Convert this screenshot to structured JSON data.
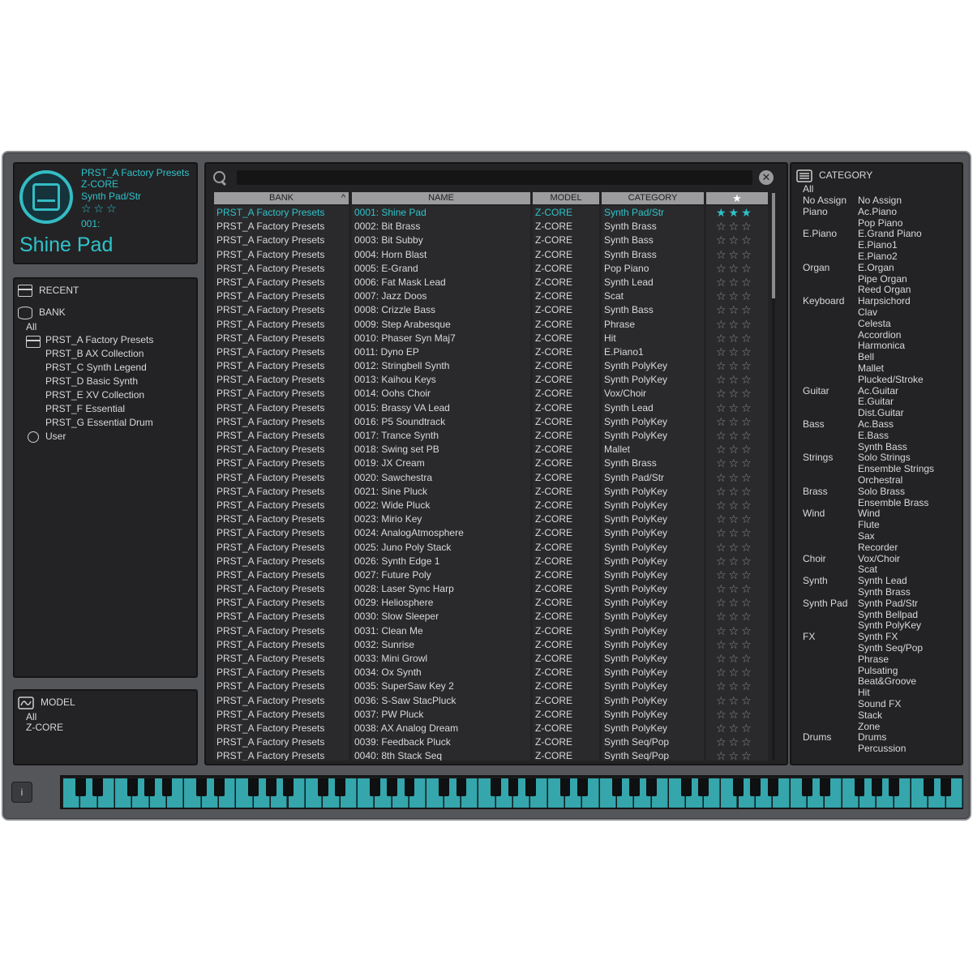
{
  "preset": {
    "bank": "PRST_A Factory Presets",
    "model": "Z-CORE",
    "category": "Synth Pad/Str",
    "stars": "☆☆☆",
    "number": "001:",
    "name": "Shine Pad"
  },
  "browser": {
    "recent_label": "RECENT",
    "bank_label": "BANK",
    "all_label": "All",
    "banks": [
      "PRST_A Factory Presets",
      "PRST_B AX Collection",
      "PRST_C Synth Legend",
      "PRST_D Basic Synth",
      "PRST_E XV Collection",
      "PRST_F Essential",
      "PRST_G Essential Drum"
    ],
    "user_label": "User"
  },
  "model_box": {
    "label": "MODEL",
    "all_label": "All",
    "item": "Z-CORE"
  },
  "search": {
    "placeholder": ""
  },
  "columns": {
    "bank": "BANK",
    "name": "NAME",
    "model": "MODEL",
    "category": "CATEGORY",
    "fav": "★"
  },
  "icons": {
    "search": "search-icon",
    "clear": "clear-icon",
    "recent": "recent-icon",
    "bank": "bank-icon",
    "user": "user-icon",
    "model": "model-wave-icon",
    "category": "category-list-icon",
    "info": "info-icon",
    "sort": "sort-up-icon"
  },
  "colors": {
    "accent": "#2fc3ca",
    "panel": "#232325",
    "frame": "#54565a",
    "header": "#9c9c9e"
  },
  "presets": [
    {
      "bank": "PRST_A Factory Presets",
      "name": "0001: Shine Pad",
      "model": "Z-CORE",
      "category": "Synth Pad/Str",
      "stars": "★★★"
    },
    {
      "bank": "PRST_A Factory Presets",
      "name": "0002: Bit Brass",
      "model": "Z-CORE",
      "category": "Synth Brass",
      "stars": "☆☆☆"
    },
    {
      "bank": "PRST_A Factory Presets",
      "name": "0003: Bit Subby",
      "model": "Z-CORE",
      "category": "Synth Bass",
      "stars": "☆☆☆"
    },
    {
      "bank": "PRST_A Factory Presets",
      "name": "0004: Horn Blast",
      "model": "Z-CORE",
      "category": "Synth Brass",
      "stars": "☆☆☆"
    },
    {
      "bank": "PRST_A Factory Presets",
      "name": "0005: E-Grand",
      "model": "Z-CORE",
      "category": "Pop Piano",
      "stars": "☆☆☆"
    },
    {
      "bank": "PRST_A Factory Presets",
      "name": "0006: Fat Mask Lead",
      "model": "Z-CORE",
      "category": "Synth Lead",
      "stars": "☆☆☆"
    },
    {
      "bank": "PRST_A Factory Presets",
      "name": "0007: Jazz Doos",
      "model": "Z-CORE",
      "category": "Scat",
      "stars": "☆☆☆"
    },
    {
      "bank": "PRST_A Factory Presets",
      "name": "0008: Crizzle Bass",
      "model": "Z-CORE",
      "category": "Synth Bass",
      "stars": "☆☆☆"
    },
    {
      "bank": "PRST_A Factory Presets",
      "name": "0009: Step Arabesque",
      "model": "Z-CORE",
      "category": "Phrase",
      "stars": "☆☆☆"
    },
    {
      "bank": "PRST_A Factory Presets",
      "name": "0010: Phaser Syn Maj7",
      "model": "Z-CORE",
      "category": "Hit",
      "stars": "☆☆☆"
    },
    {
      "bank": "PRST_A Factory Presets",
      "name": "0011: Dyno EP",
      "model": "Z-CORE",
      "category": "E.Piano1",
      "stars": "☆☆☆"
    },
    {
      "bank": "PRST_A Factory Presets",
      "name": "0012: Stringbell Synth",
      "model": "Z-CORE",
      "category": "Synth PolyKey",
      "stars": "☆☆☆"
    },
    {
      "bank": "PRST_A Factory Presets",
      "name": "0013: Kaihou Keys",
      "model": "Z-CORE",
      "category": "Synth PolyKey",
      "stars": "☆☆☆"
    },
    {
      "bank": "PRST_A Factory Presets",
      "name": "0014: Oohs Choir",
      "model": "Z-CORE",
      "category": "Vox/Choir",
      "stars": "☆☆☆"
    },
    {
      "bank": "PRST_A Factory Presets",
      "name": "0015: Brassy VA Lead",
      "model": "Z-CORE",
      "category": "Synth Lead",
      "stars": "☆☆☆"
    },
    {
      "bank": "PRST_A Factory Presets",
      "name": "0016: P5 Soundtrack",
      "model": "Z-CORE",
      "category": "Synth PolyKey",
      "stars": "☆☆☆"
    },
    {
      "bank": "PRST_A Factory Presets",
      "name": "0017: Trance Synth",
      "model": "Z-CORE",
      "category": "Synth PolyKey",
      "stars": "☆☆☆"
    },
    {
      "bank": "PRST_A Factory Presets",
      "name": "0018: Swing set PB",
      "model": "Z-CORE",
      "category": "Mallet",
      "stars": "☆☆☆"
    },
    {
      "bank": "PRST_A Factory Presets",
      "name": "0019: JX Cream",
      "model": "Z-CORE",
      "category": "Synth Brass",
      "stars": "☆☆☆"
    },
    {
      "bank": "PRST_A Factory Presets",
      "name": "0020: Sawchestra",
      "model": "Z-CORE",
      "category": "Synth Pad/Str",
      "stars": "☆☆☆"
    },
    {
      "bank": "PRST_A Factory Presets",
      "name": "0021: Sine Pluck",
      "model": "Z-CORE",
      "category": "Synth PolyKey",
      "stars": "☆☆☆"
    },
    {
      "bank": "PRST_A Factory Presets",
      "name": "0022: Wide Pluck",
      "model": "Z-CORE",
      "category": "Synth PolyKey",
      "stars": "☆☆☆"
    },
    {
      "bank": "PRST_A Factory Presets",
      "name": "0023: Mirio Key",
      "model": "Z-CORE",
      "category": "Synth PolyKey",
      "stars": "☆☆☆"
    },
    {
      "bank": "PRST_A Factory Presets",
      "name": "0024: AnalogAtmosphere",
      "model": "Z-CORE",
      "category": "Synth PolyKey",
      "stars": "☆☆☆"
    },
    {
      "bank": "PRST_A Factory Presets",
      "name": "0025: Juno Poly Stack",
      "model": "Z-CORE",
      "category": "Synth PolyKey",
      "stars": "☆☆☆"
    },
    {
      "bank": "PRST_A Factory Presets",
      "name": "0026: Synth Edge 1",
      "model": "Z-CORE",
      "category": "Synth PolyKey",
      "stars": "☆☆☆"
    },
    {
      "bank": "PRST_A Factory Presets",
      "name": "0027: Future Poly",
      "model": "Z-CORE",
      "category": "Synth PolyKey",
      "stars": "☆☆☆"
    },
    {
      "bank": "PRST_A Factory Presets",
      "name": "0028: Laser Sync Harp",
      "model": "Z-CORE",
      "category": "Synth PolyKey",
      "stars": "☆☆☆"
    },
    {
      "bank": "PRST_A Factory Presets",
      "name": "0029: Heliosphere",
      "model": "Z-CORE",
      "category": "Synth PolyKey",
      "stars": "☆☆☆"
    },
    {
      "bank": "PRST_A Factory Presets",
      "name": "0030: Slow Sleeper",
      "model": "Z-CORE",
      "category": "Synth PolyKey",
      "stars": "☆☆☆"
    },
    {
      "bank": "PRST_A Factory Presets",
      "name": "0031: Clean Me",
      "model": "Z-CORE",
      "category": "Synth PolyKey",
      "stars": "☆☆☆"
    },
    {
      "bank": "PRST_A Factory Presets",
      "name": "0032: Sunrise",
      "model": "Z-CORE",
      "category": "Synth PolyKey",
      "stars": "☆☆☆"
    },
    {
      "bank": "PRST_A Factory Presets",
      "name": "0033: Mini Growl",
      "model": "Z-CORE",
      "category": "Synth PolyKey",
      "stars": "☆☆☆"
    },
    {
      "bank": "PRST_A Factory Presets",
      "name": "0034: Ox Synth",
      "model": "Z-CORE",
      "category": "Synth PolyKey",
      "stars": "☆☆☆"
    },
    {
      "bank": "PRST_A Factory Presets",
      "name": "0035: SuperSaw Key 2",
      "model": "Z-CORE",
      "category": "Synth PolyKey",
      "stars": "☆☆☆"
    },
    {
      "bank": "PRST_A Factory Presets",
      "name": "0036: S-Saw StacPluck",
      "model": "Z-CORE",
      "category": "Synth PolyKey",
      "stars": "☆☆☆"
    },
    {
      "bank": "PRST_A Factory Presets",
      "name": "0037: PW Pluck",
      "model": "Z-CORE",
      "category": "Synth PolyKey",
      "stars": "☆☆☆"
    },
    {
      "bank": "PRST_A Factory Presets",
      "name": "0038: AX Analog Dream",
      "model": "Z-CORE",
      "category": "Synth PolyKey",
      "stars": "☆☆☆"
    },
    {
      "bank": "PRST_A Factory Presets",
      "name": "0039: Feedback Pluck",
      "model": "Z-CORE",
      "category": "Synth Seq/Pop",
      "stars": "☆☆☆"
    },
    {
      "bank": "PRST_A Factory Presets",
      "name": "0040: 8th Stack Seq",
      "model": "Z-CORE",
      "category": "Synth Seq/Pop",
      "stars": "☆☆☆"
    }
  ],
  "category_panel": {
    "label": "CATEGORY",
    "all_label": "All",
    "groups": [
      {
        "group": "No Assign",
        "subs": [
          "No Assign"
        ]
      },
      {
        "group": "Piano",
        "subs": [
          "Ac.Piano",
          "Pop Piano"
        ]
      },
      {
        "group": "E.Piano",
        "subs": [
          "E.Grand Piano",
          "E.Piano1",
          "E.Piano2"
        ]
      },
      {
        "group": "Organ",
        "subs": [
          "E.Organ",
          "Pipe Organ",
          "Reed Organ"
        ]
      },
      {
        "group": "Keyboard",
        "subs": [
          "Harpsichord",
          "Clav",
          "Celesta",
          "Accordion",
          "Harmonica",
          "Bell",
          "Mallet",
          "Plucked/Stroke"
        ]
      },
      {
        "group": "Guitar",
        "subs": [
          "Ac.Guitar",
          "E.Guitar",
          "Dist.Guitar"
        ]
      },
      {
        "group": "Bass",
        "subs": [
          "Ac.Bass",
          "E.Bass",
          "Synth Bass"
        ]
      },
      {
        "group": "Strings",
        "subs": [
          "Solo Strings",
          "Ensemble Strings",
          "Orchestral"
        ]
      },
      {
        "group": "Brass",
        "subs": [
          "Solo Brass",
          "Ensemble Brass"
        ]
      },
      {
        "group": "Wind",
        "subs": [
          "Wind",
          "Flute",
          "Sax",
          "Recorder"
        ]
      },
      {
        "group": "Choir",
        "subs": [
          "Vox/Choir",
          "Scat"
        ]
      },
      {
        "group": "Synth",
        "subs": [
          "Synth Lead",
          "Synth Brass"
        ]
      },
      {
        "group": "Synth Pad",
        "subs": [
          "Synth Pad/Str",
          "Synth Bellpad",
          "Synth PolyKey"
        ]
      },
      {
        "group": "FX",
        "subs": [
          "Synth FX",
          "Synth Seq/Pop",
          "Phrase",
          "Pulsating",
          "Beat&Groove",
          "Hit",
          "Sound FX",
          "Stack",
          "Zone"
        ]
      },
      {
        "group": "Drums",
        "subs": [
          "Drums",
          "Percussion"
        ]
      }
    ]
  },
  "info_button": "i"
}
